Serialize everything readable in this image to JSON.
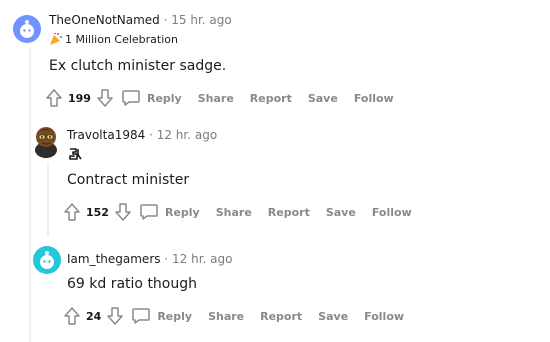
{
  "comments": [
    {
      "username": "TheOneNotNamed",
      "separator": "·",
      "time": "15 hr. ago",
      "flair": "1 Million Celebration",
      "flair_icon": "party-popper-icon",
      "text": "Ex clutch minister sadge.",
      "score": "199",
      "actions": {
        "reply": "Reply",
        "share": "Share",
        "report": "Report",
        "save": "Save",
        "follow": "Follow"
      }
    },
    {
      "username": "Travolta1984",
      "separator": "·",
      "time": "12 hr. ago",
      "flair_icon": "sk-gaming-logo-icon",
      "text": "Contract minister",
      "score": "152",
      "actions": {
        "reply": "Reply",
        "share": "Share",
        "report": "Report",
        "save": "Save",
        "follow": "Follow"
      }
    },
    {
      "username": "Iam_thegamers",
      "separator": "·",
      "time": "12 hr. ago",
      "text": "69 kd ratio though",
      "score": "24",
      "actions": {
        "reply": "Reply",
        "share": "Share",
        "report": "Report",
        "save": "Save",
        "follow": "Follow"
      }
    }
  ],
  "colors": {
    "avatar_default": "#7193ff",
    "avatar_teal": "#24c6dc",
    "thread_line": "#edeff1",
    "meta_gray": "#7c7c7c"
  }
}
